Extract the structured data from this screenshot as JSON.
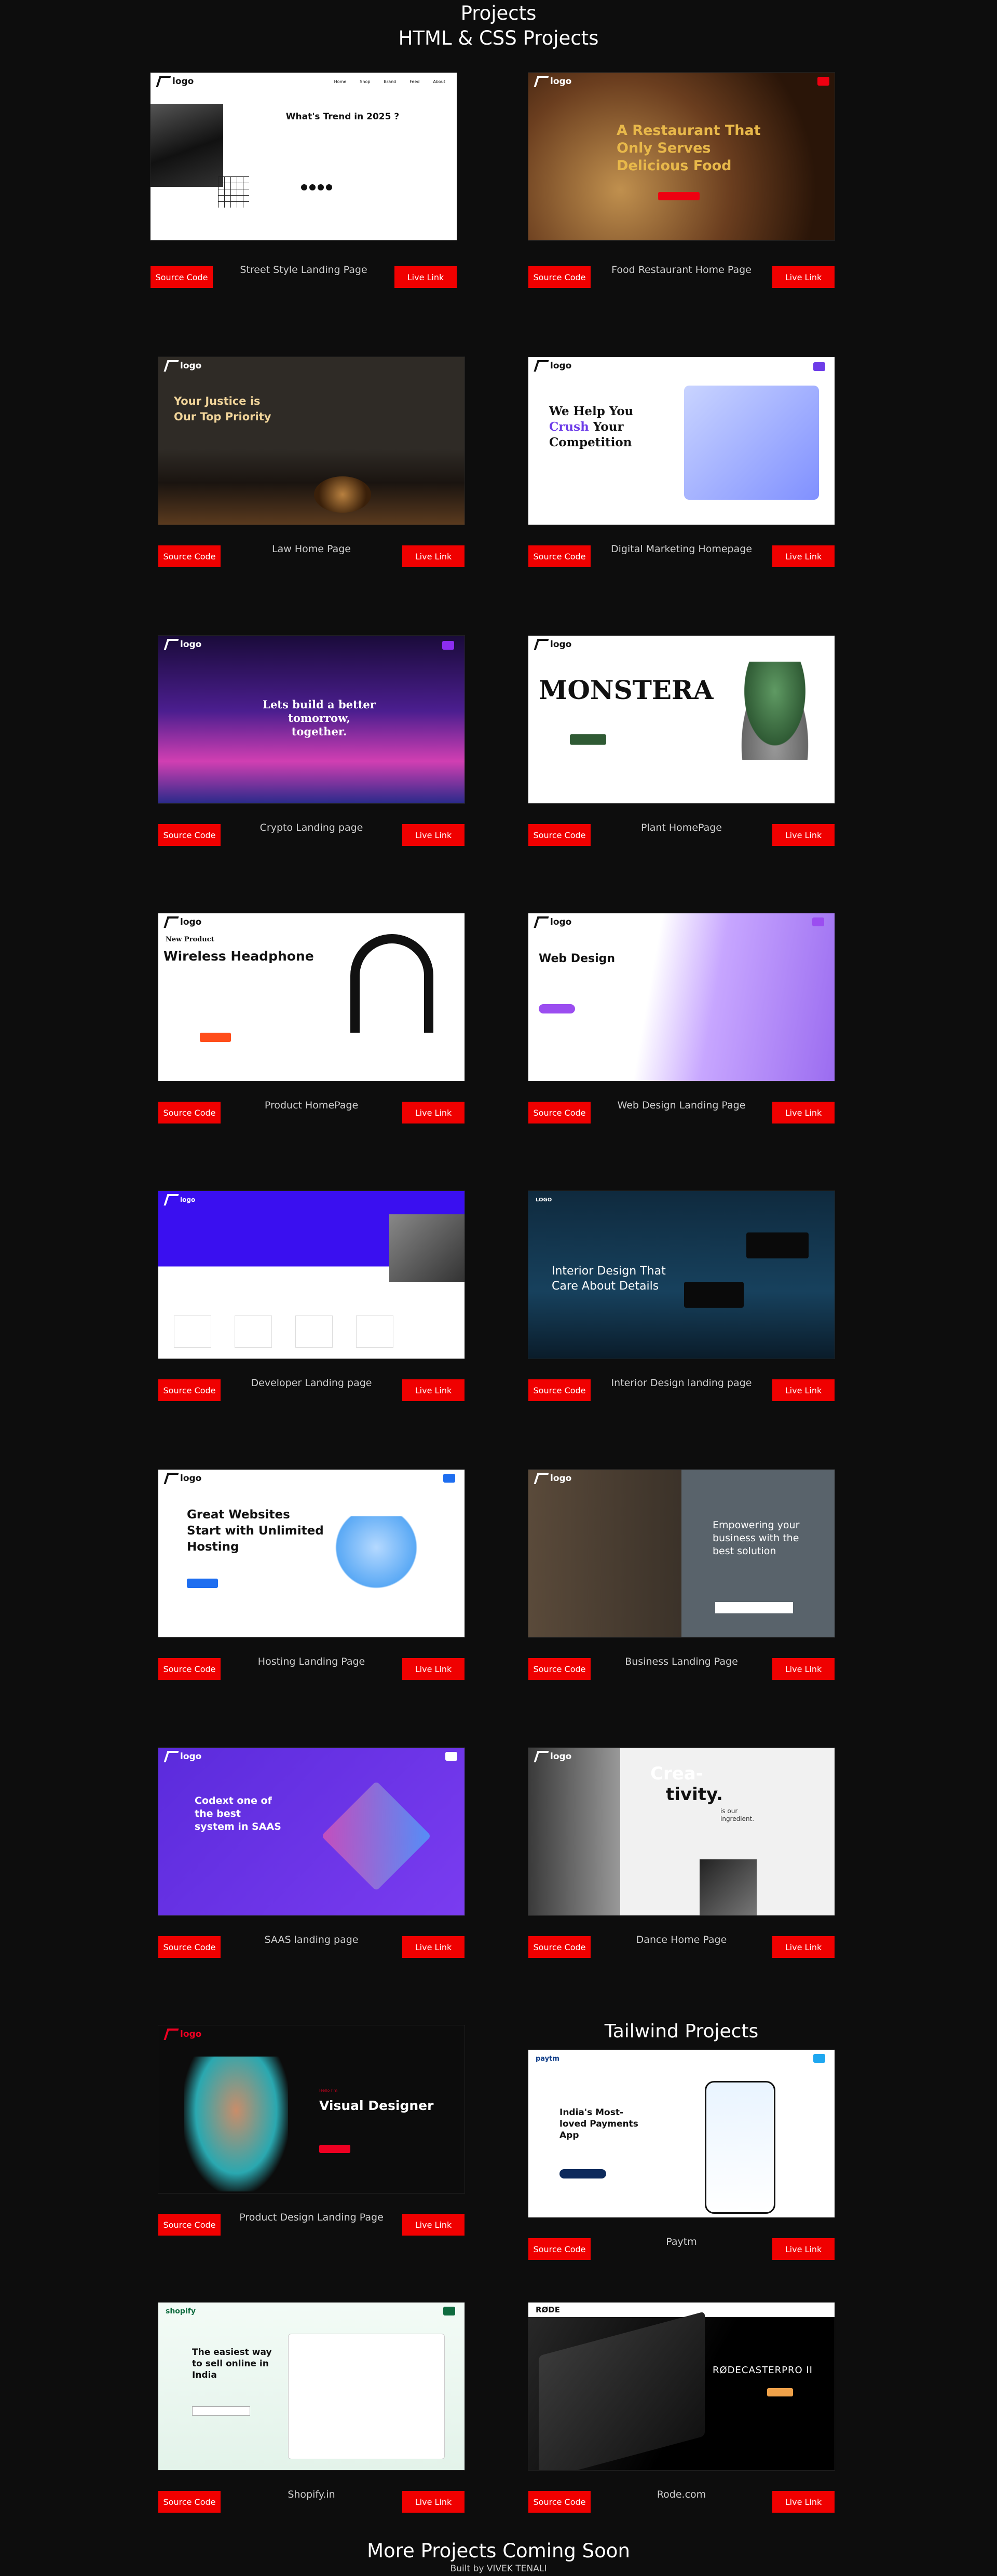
{
  "header": {
    "title": "Projects",
    "subtitle": "HTML & CSS Projects"
  },
  "buttons": {
    "source": "Source Code",
    "live": "Live Link"
  },
  "cards": [
    {
      "title": "Street Style Landing Page",
      "headline": "What's Trend in 2025 ?",
      "logo": "logo",
      "nav": [
        "Home",
        "Shop",
        "Brand",
        "Feed",
        "About"
      ]
    },
    {
      "title": "Food Restaurant Home Page",
      "headline": "A Restaurant That Only Serves Delicious Food",
      "logo": "logo"
    },
    {
      "title": "Law Home Page",
      "headline": "Your Justice is Our Top Priority",
      "logo": "logo"
    },
    {
      "title": "Digital Marketing Homepage",
      "headline_a": "We Help You",
      "headline_b": "Crush",
      "headline_c": "Your Competition",
      "logo": "logo"
    },
    {
      "title": "Crypto Landing page",
      "headline": "Lets build a better tomorrow, together.",
      "logo": "logo"
    },
    {
      "title": "Plant HomePage",
      "headline": "MONSTERA",
      "logo": "logo"
    },
    {
      "title": "Product HomePage",
      "kicker": "New Product",
      "headline": "Wireless Headphone",
      "logo": "logo"
    },
    {
      "title": "Web Design Landing Page",
      "headline": "Web Design",
      "logo": "logo"
    },
    {
      "title": "Developer Landing page",
      "logo": "logo"
    },
    {
      "title": "Interior Design landing page",
      "headline": "Interior Design That Care About Details",
      "logo": "LOGO"
    },
    {
      "title": "Hosting Landing Page",
      "headline": "Great Websites Start with Unlimited Hosting",
      "logo": "logo"
    },
    {
      "title": "Business Landing Page",
      "headline": "Empowering your business with the best solution",
      "logo": "logo"
    },
    {
      "title": "SAAS landing page",
      "headline": "Codext one of the best system in SAAS",
      "logo": "logo"
    },
    {
      "title": "Dance Home Page",
      "headline_a": "Crea-",
      "headline_b": "tivity.",
      "sub": "is our ingredient.",
      "logo": "logo"
    },
    {
      "title": "Product Design Landing Page",
      "kicker": "Hello I'm",
      "headline": "Visual Designer",
      "logo": "logo"
    },
    {
      "title": "Paytm",
      "headline": "India's Most-loved Payments App",
      "logo": "paytm"
    },
    {
      "title": "Shopify.in",
      "headline": "The easiest way to sell online in India",
      "logo": "shopify"
    },
    {
      "title": "Rode.com",
      "headline": "RØDECASTERPRO II",
      "logo": "RØDE"
    }
  ],
  "tailwind_label": "Tailwind Projects",
  "footer": {
    "more": "More Projects Coming Soon",
    "built": "Built by VIVEK TENALI"
  },
  "colors": {
    "background": "#0d0d0d",
    "button": "#f00000",
    "text": "#ffffff"
  }
}
